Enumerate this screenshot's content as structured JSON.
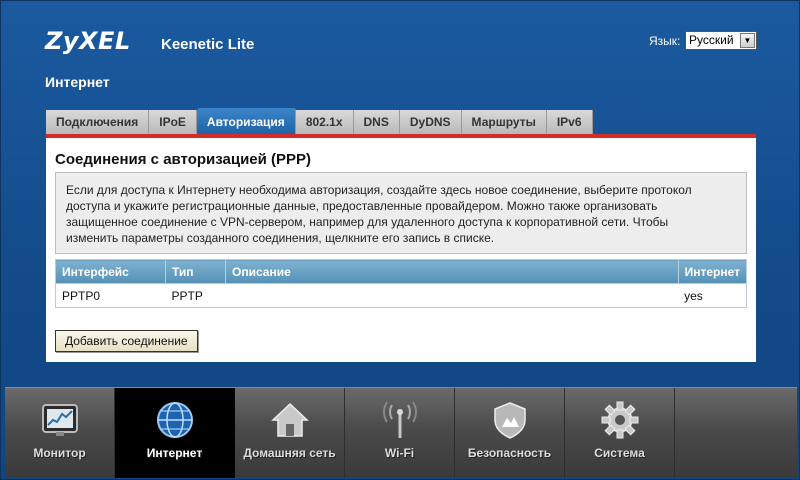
{
  "header": {
    "brand": "ZyXEL",
    "model": "Keenetic Lite",
    "language_label": "Язык:",
    "language_value": "Русский"
  },
  "page": {
    "title": "Интернет"
  },
  "tabs": [
    {
      "label": "Подключения",
      "active": false
    },
    {
      "label": "IPoE",
      "active": false
    },
    {
      "label": "Авторизация",
      "active": true
    },
    {
      "label": "802.1x",
      "active": false
    },
    {
      "label": "DNS",
      "active": false
    },
    {
      "label": "DyDNS",
      "active": false
    },
    {
      "label": "Маршруты",
      "active": false
    },
    {
      "label": "IPv6",
      "active": false
    }
  ],
  "panel": {
    "title": "Соединения с авторизацией (PPP)",
    "info": "Если для доступа к Интернету необходима авторизация, создайте здесь новое соединение, выберите протокол доступа и укажите регистрационные данные, предоставленные провайдером. Можно также организовать защищенное соединение с VPN-сервером, например для удаленного доступа к корпоративной сети. Чтобы изменить параметры созданного соединения, щелкните его запись в списке.",
    "table": {
      "headers": [
        "Интерфейс",
        "Тип",
        "Описание",
        "Интернет"
      ],
      "rows": [
        [
          "PPTP0",
          "PPTP",
          "",
          "yes"
        ]
      ]
    },
    "add_button": "Добавить соединение"
  },
  "nav": [
    {
      "label": "Монитор",
      "icon": "monitor-icon",
      "active": false
    },
    {
      "label": "Интернет",
      "icon": "globe-icon",
      "active": true
    },
    {
      "label": "Домашняя сеть",
      "icon": "home-icon",
      "active": false
    },
    {
      "label": "Wi-Fi",
      "icon": "wifi-antenna-icon",
      "active": false
    },
    {
      "label": "Безопасность",
      "icon": "shield-icon",
      "active": false
    },
    {
      "label": "Система",
      "icon": "gear-icon",
      "active": false
    }
  ],
  "colors": {
    "background": "#16508f",
    "active_tab": "#2a72b8",
    "tab_underline": "#d42b2b",
    "table_header": "#6aa2c3"
  }
}
